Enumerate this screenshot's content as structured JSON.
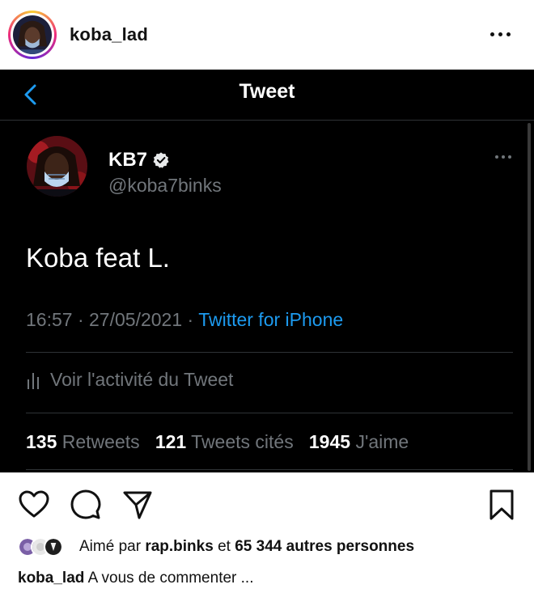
{
  "post": {
    "username": "koba_lad"
  },
  "tweet": {
    "nav_title": "Tweet",
    "display_name": "KB7",
    "handle": "@koba7binks",
    "text": "Koba feat L.",
    "time": "16:57",
    "date": "27/05/2021",
    "separator": "·",
    "source": "Twitter for iPhone",
    "activity_label": "Voir l'activité du Tweet",
    "stats": {
      "retweets_count": "135",
      "retweets_label": "Retweets",
      "quotes_count": "121",
      "quotes_label": "Tweets cités",
      "likes_count": "1945",
      "likes_label": "J'aime"
    },
    "colors": {
      "background": "#000000",
      "link": "#1d9bf0",
      "secondary_text": "#71767b"
    }
  },
  "likes": {
    "prefix": "Aimé par",
    "liked_by": "rap.binks",
    "conjunction": "et",
    "others_count": "65 344",
    "others_label": "autres personnes"
  },
  "caption": {
    "username": "koba_lad",
    "text": "A vous de commenter ..."
  },
  "icons": [
    "more-icon",
    "back-arrow-icon",
    "verified-badge-icon",
    "activity-chart-icon",
    "heart-icon",
    "comment-icon",
    "share-icon",
    "bookmark-icon"
  ]
}
